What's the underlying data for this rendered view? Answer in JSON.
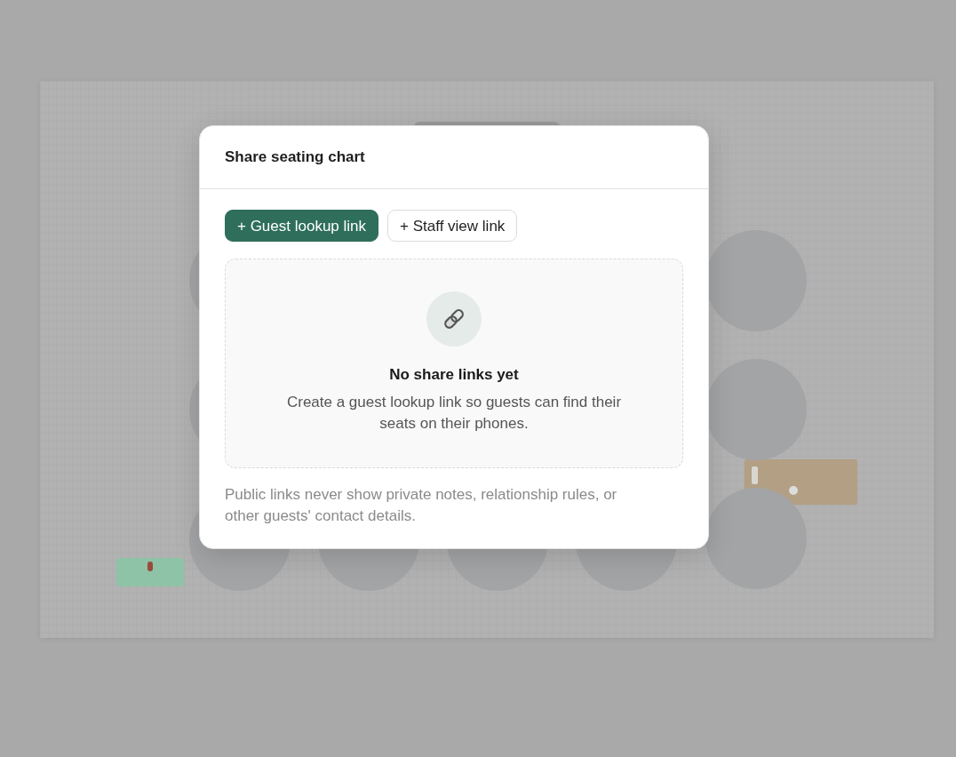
{
  "canvas": {
    "items": [
      {
        "kind": "round-table"
      },
      {
        "kind": "round-table"
      },
      {
        "kind": "round-table"
      },
      {
        "kind": "round-table"
      },
      {
        "kind": "round-table"
      },
      {
        "kind": "round-table"
      },
      {
        "kind": "round-table"
      },
      {
        "kind": "round-table"
      },
      {
        "kind": "round-table"
      },
      {
        "kind": "head-table"
      },
      {
        "kind": "entrance"
      },
      {
        "kind": "toolbar"
      }
    ]
  },
  "dialog": {
    "title": "Share seating chart",
    "actions": [
      {
        "label": "+ Guest lookup link",
        "kind": "primary"
      },
      {
        "label": "+ Staff view link",
        "kind": "secondary"
      }
    ],
    "empty_state": {
      "title": "No share links yet",
      "description": "Create a guest lookup link so guests can find their seats on their phones."
    },
    "note": "Public links never show private notes, relationship rules, or other guests' contact details."
  }
}
